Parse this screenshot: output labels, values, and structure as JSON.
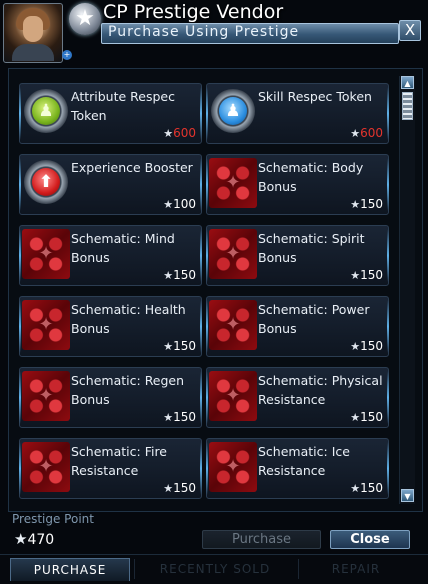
{
  "header": {
    "title": "CP Prestige Vendor",
    "subtitle": "Purchase Using Prestige",
    "close_glyph": "X",
    "star_badge_glyph": "★",
    "small_badge_glyph": "+"
  },
  "items": [
    {
      "name": "Attribute Respec Token",
      "cost": "600",
      "affordable": false,
      "icon": "green-attribute-orb-icon",
      "glyph": "♟"
    },
    {
      "name": "Skill Respec Token",
      "cost": "600",
      "affordable": false,
      "icon": "blue-skill-orb-icon",
      "glyph": "♟"
    },
    {
      "name": "Experience Booster",
      "cost": "100",
      "affordable": true,
      "icon": "red-arrow-orb-icon",
      "glyph": "⬆"
    },
    {
      "name": "Schematic: Body Bonus",
      "cost": "150",
      "affordable": true,
      "icon": "schematic-icon"
    },
    {
      "name": "Schematic: Mind Bonus",
      "cost": "150",
      "affordable": true,
      "icon": "schematic-icon"
    },
    {
      "name": "Schematic: Spirit Bonus",
      "cost": "150",
      "affordable": true,
      "icon": "schematic-icon"
    },
    {
      "name": "Schematic: Health Bonus",
      "cost": "150",
      "affordable": true,
      "icon": "schematic-icon"
    },
    {
      "name": "Schematic: Power Bonus",
      "cost": "150",
      "affordable": true,
      "icon": "schematic-icon"
    },
    {
      "name": "Schematic: Regen Bonus",
      "cost": "150",
      "affordable": true,
      "icon": "schematic-icon"
    },
    {
      "name": "Schematic: Physical Resistance",
      "cost": "150",
      "affordable": true,
      "icon": "schematic-icon"
    },
    {
      "name": "Schematic: Fire Resistance",
      "cost": "150",
      "affordable": true,
      "icon": "schematic-icon"
    },
    {
      "name": "Schematic: Ice Resistance",
      "cost": "150",
      "affordable": true,
      "icon": "schematic-icon"
    }
  ],
  "cost_star": "★",
  "scrollbar": {
    "up_glyph": "▲",
    "down_glyph": "▼"
  },
  "footer": {
    "prestige_label": "Prestige Point",
    "prestige_star": "★",
    "prestige_value": "470",
    "purchase_label": "Purchase",
    "close_label": "Close"
  },
  "tabs": [
    {
      "label": "PURCHASE",
      "active": true
    },
    {
      "label": "RECENTLY SOLD",
      "active": false
    },
    {
      "label": "REPAIR",
      "active": false
    }
  ],
  "colors": {
    "accent": "#5fb0e8",
    "unaffordable": "#e3342d"
  }
}
